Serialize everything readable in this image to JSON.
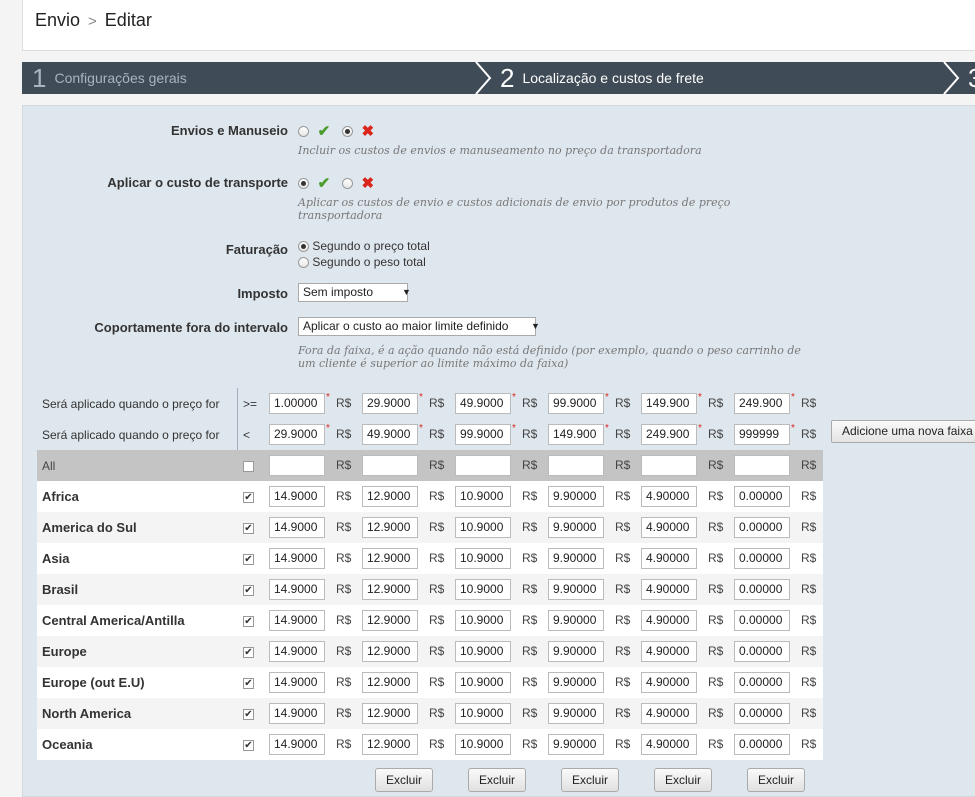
{
  "breadcrumb": {
    "root": "Envio",
    "separator": ">",
    "current": "Editar"
  },
  "steps": [
    {
      "num": "1",
      "label": "Configurações gerais"
    },
    {
      "num": "2",
      "label": "Localização e custos de frete"
    },
    {
      "num": "3",
      "label": ""
    }
  ],
  "form": {
    "handling": {
      "label": "Envios e Manuseio",
      "selected": "no",
      "hint": "Incluir os custos de envios e manuseamento no preço da transportadora"
    },
    "transport": {
      "label": "Aplicar o custo de transporte",
      "selected": "yes",
      "hint_line1": "Aplicar os custos de envio e custos adicionais de envio por produtos de preço",
      "hint_line2": "transportadora"
    },
    "billing": {
      "label": "Faturação",
      "option1": "Segundo o preço total",
      "option2": "Segundo o peso total",
      "selected": "option1"
    },
    "tax": {
      "label": "Imposto",
      "value": "Sem imposto"
    },
    "out_of_range": {
      "label": "Coportamente fora do intervalo",
      "value": "Aplicar o custo ao maior limite definido",
      "hint_line1": "Fora da faixa, é a ação quando não está definido (por exemplo, quando o peso carrinho de",
      "hint_line2": "um cliente é superior ao limite máximo da faixa)"
    }
  },
  "ranges": {
    "label": "Será aplicado quando o preço for",
    "op_from": ">=",
    "op_to": "<",
    "currency": "R$",
    "from": [
      "1.00000",
      "29.9000",
      "49.9000",
      "99.9000",
      "149.900",
      "249.900"
    ],
    "to": [
      "29.9000",
      "49.9000",
      "99.9000",
      "149.900",
      "249.900",
      "999999"
    ],
    "add_button": "Adicione uma nova faixa"
  },
  "all_row": {
    "label": "All",
    "values": [
      "",
      "",
      "",
      "",
      "",
      ""
    ]
  },
  "zones": [
    {
      "name": "Africa",
      "checked": true,
      "prices": [
        "14.9000",
        "12.9000",
        "10.9000",
        "9.90000",
        "4.90000",
        "0.00000"
      ]
    },
    {
      "name": "America do Sul",
      "checked": true,
      "prices": [
        "14.9000",
        "12.9000",
        "10.9000",
        "9.90000",
        "4.90000",
        "0.00000"
      ]
    },
    {
      "name": "Asia",
      "checked": true,
      "prices": [
        "14.9000",
        "12.9000",
        "10.9000",
        "9.90000",
        "4.90000",
        "0.00000"
      ]
    },
    {
      "name": "Brasil",
      "checked": true,
      "prices": [
        "14.9000",
        "12.9000",
        "10.9000",
        "9.90000",
        "4.90000",
        "0.00000"
      ]
    },
    {
      "name": "Central America/Antilla",
      "checked": true,
      "prices": [
        "14.9000",
        "12.9000",
        "10.9000",
        "9.90000",
        "4.90000",
        "0.00000"
      ]
    },
    {
      "name": "Europe",
      "checked": true,
      "prices": [
        "14.9000",
        "12.9000",
        "10.9000",
        "9.90000",
        "4.90000",
        "0.00000"
      ]
    },
    {
      "name": "Europe (out E.U)",
      "checked": true,
      "prices": [
        "14.9000",
        "12.9000",
        "10.9000",
        "9.90000",
        "4.90000",
        "0.00000"
      ]
    },
    {
      "name": "North America",
      "checked": true,
      "prices": [
        "14.9000",
        "12.9000",
        "10.9000",
        "9.90000",
        "4.90000",
        "0.00000"
      ]
    },
    {
      "name": "Oceania",
      "checked": true,
      "prices": [
        "14.9000",
        "12.9000",
        "10.9000",
        "9.90000",
        "4.90000",
        "0.00000"
      ]
    }
  ],
  "delete_label": "Excluir"
}
